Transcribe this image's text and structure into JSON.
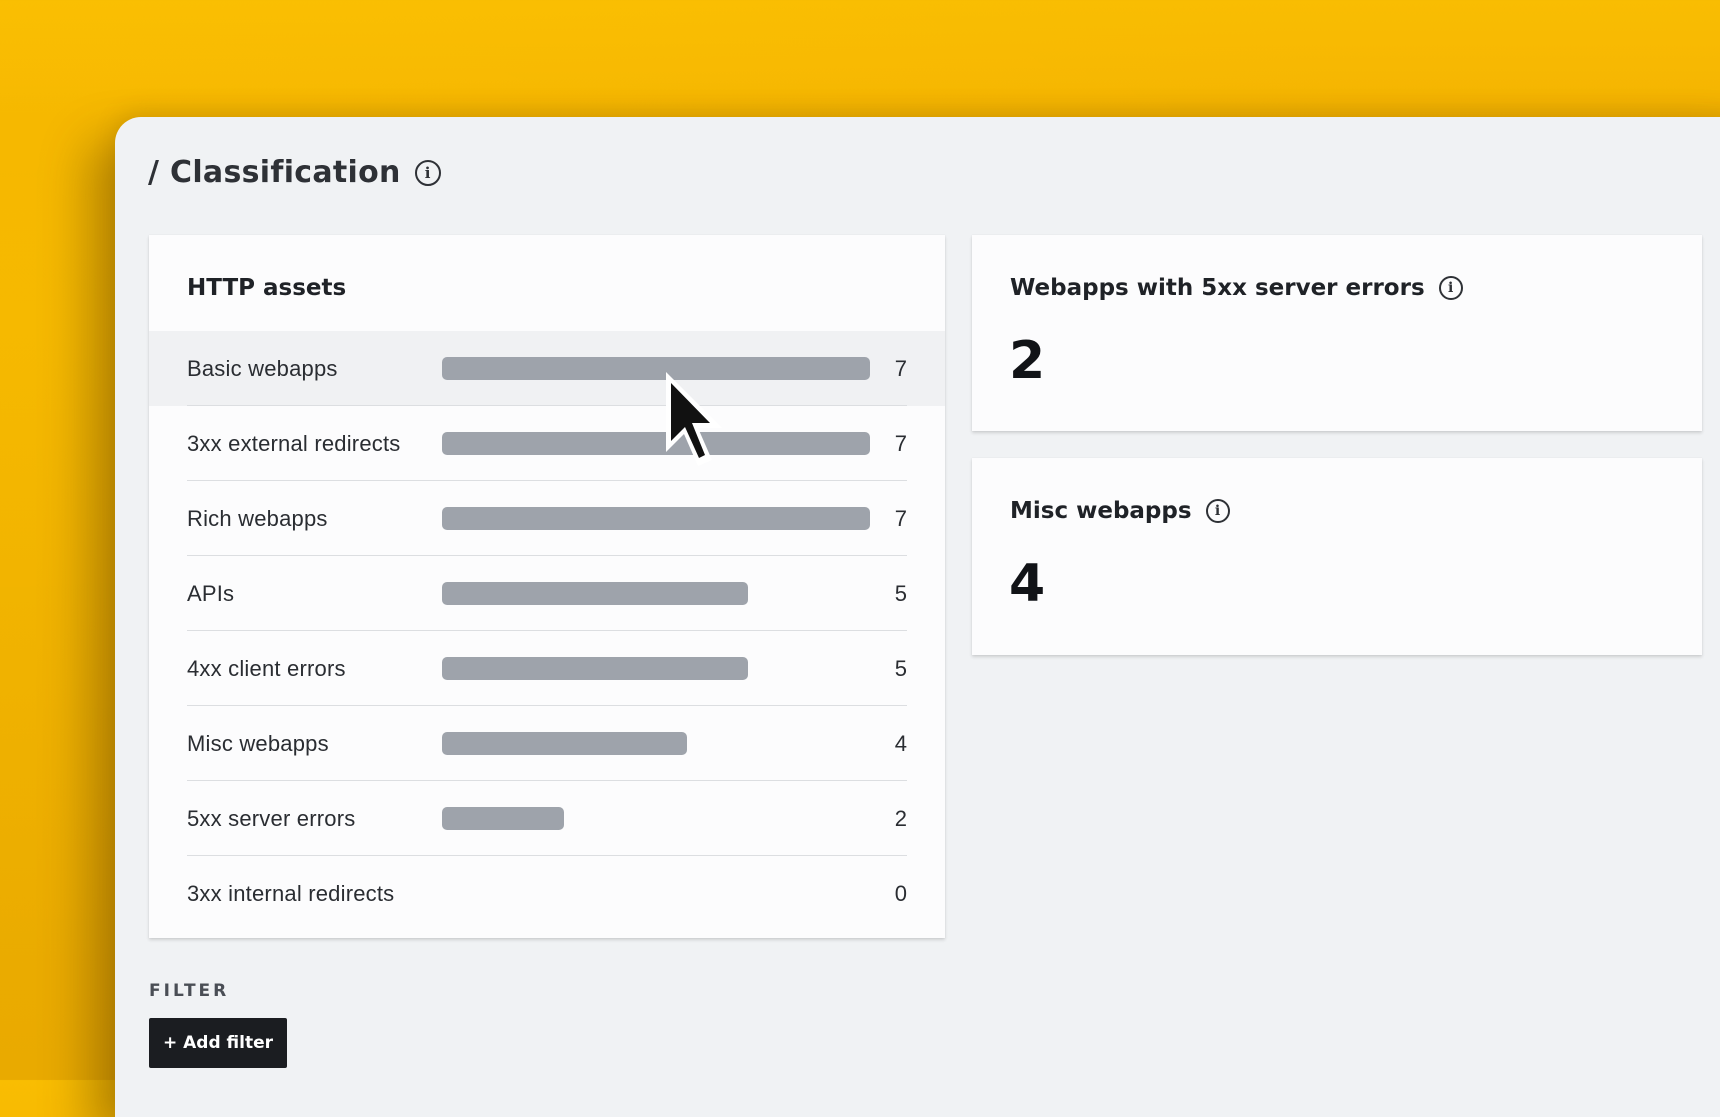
{
  "page": {
    "title": "/ Classification"
  },
  "http_assets": {
    "title": "HTTP assets",
    "max": 7,
    "rows": [
      {
        "label": "Basic webapps",
        "count": 7
      },
      {
        "label": "3xx external redirects",
        "count": 7
      },
      {
        "label": "Rich webapps",
        "count": 7
      },
      {
        "label": "APIs",
        "count": 5
      },
      {
        "label": "4xx client errors",
        "count": 5
      },
      {
        "label": "Misc webapps",
        "count": 4
      },
      {
        "label": "5xx server errors",
        "count": 2
      },
      {
        "label": "3xx internal redirects",
        "count": 0
      }
    ],
    "hovered_row": "Basic webapps"
  },
  "metrics": [
    {
      "title": "Webapps with 5xx server errors",
      "value": "2"
    },
    {
      "title": "Misc webapps",
      "value": "4"
    }
  ],
  "filter": {
    "label": "FILTER",
    "add_button": "+ Add filter"
  },
  "colors": {
    "background": "#f7b802",
    "window": "#f0f2f4",
    "card": "#fcfcfd",
    "bar": "#9ea3ab",
    "button": "#1b1d21"
  },
  "icons": {
    "title": "info-icon",
    "metric": "info-icon",
    "pointer": "mouse-cursor-icon"
  }
}
